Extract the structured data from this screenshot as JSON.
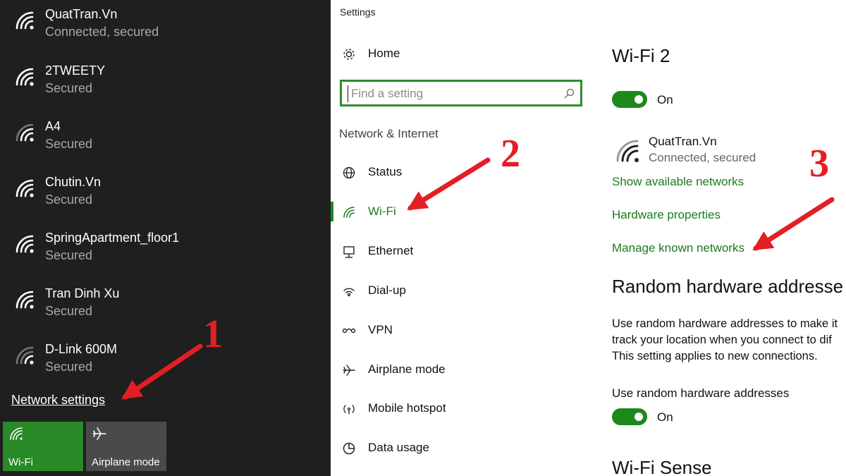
{
  "flyout": {
    "networks": [
      {
        "name": "QuatTran.Vn",
        "status": "Connected, secured"
      },
      {
        "name": "2TWEETY",
        "status": "Secured"
      },
      {
        "name": "A4",
        "status": "Secured"
      },
      {
        "name": "Chutin.Vn",
        "status": "Secured"
      },
      {
        "name": "SpringApartment_floor1",
        "status": "Secured"
      },
      {
        "name": "Tran Dinh Xu",
        "status": "Secured"
      },
      {
        "name": "D-Link 600M",
        "status": "Secured"
      }
    ],
    "network_settings_label": "Network settings",
    "tiles": [
      {
        "label": "Wi-Fi",
        "icon": "wifi-icon",
        "color": "#2a8a27"
      },
      {
        "label": "Airplane mode",
        "icon": "airplane-icon",
        "color": "#4a4a4a"
      }
    ]
  },
  "settings": {
    "window_title": "Settings",
    "home_label": "Home",
    "search": {
      "value": "",
      "placeholder": "Find a setting"
    },
    "section_label": "Network & Internet",
    "nav": [
      {
        "label": "Status",
        "icon": "globe-icon"
      },
      {
        "label": "Wi-Fi",
        "icon": "wifi-icon"
      },
      {
        "label": "Ethernet",
        "icon": "ethernet-icon"
      },
      {
        "label": "Dial-up",
        "icon": "dialup-icon"
      },
      {
        "label": "VPN",
        "icon": "vpn-icon"
      },
      {
        "label": "Airplane mode",
        "icon": "airplane-icon"
      },
      {
        "label": "Mobile hotspot",
        "icon": "hotspot-icon"
      },
      {
        "label": "Data usage",
        "icon": "data-usage-icon"
      }
    ],
    "accent_color": "#1b8a1b"
  },
  "content": {
    "title": "Wi-Fi 2",
    "wifi_toggle": {
      "state": "On"
    },
    "current_network": {
      "name": "QuatTran.Vn",
      "status": "Connected, secured"
    },
    "links": [
      "Show available networks",
      "Hardware properties",
      "Manage known networks"
    ],
    "random_hw_heading": "Random hardware addresse",
    "random_hw_description": [
      "Use random hardware addresses to make it",
      "track your location when you connect to dif",
      "This setting applies to new connections."
    ],
    "random_hw_toggle_label": "Use random hardware addresses",
    "random_hw_toggle": {
      "state": "On"
    },
    "wifi_sense_heading": "Wi-Fi Sense"
  },
  "annotations": {
    "step1": "1",
    "step2": "2",
    "step3": "3",
    "color": "#e31e24"
  }
}
